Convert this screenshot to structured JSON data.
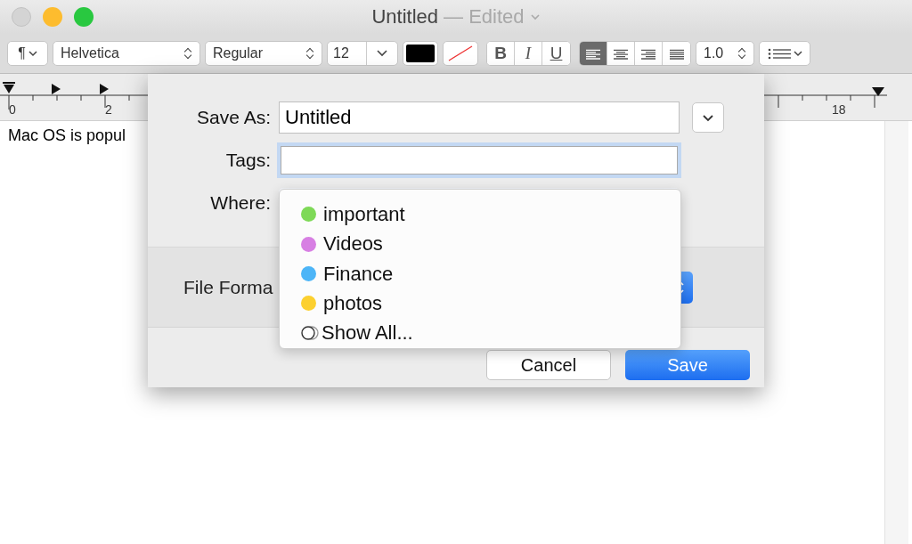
{
  "window": {
    "title": "Untitled",
    "status": "— Edited"
  },
  "toolbar": {
    "paragraph": "¶",
    "font_family": "Helvetica",
    "font_style": "Regular",
    "font_size": "12",
    "bold": "B",
    "italic": "I",
    "underline": "U",
    "line_spacing": "1.0",
    "alignments": [
      {
        "kind": "left",
        "selected": true
      },
      {
        "kind": "center",
        "selected": false
      },
      {
        "kind": "right",
        "selected": false
      },
      {
        "kind": "justify",
        "selected": false
      }
    ]
  },
  "ruler": {
    "labels": [
      "0",
      "2",
      "18"
    ]
  },
  "document": {
    "text": "Mac OS is popul"
  },
  "save_dialog": {
    "save_as_label": "Save As:",
    "save_as_value": "Untitled",
    "tags_label": "Tags:",
    "where_label": "Where:",
    "file_format_label": "File Forma",
    "tags_menu": [
      {
        "kind": "tag",
        "label": "important",
        "color": "#7ed957"
      },
      {
        "kind": "tag",
        "label": "Videos",
        "color": "#d77fe3"
      },
      {
        "kind": "tag",
        "label": "Finance",
        "color": "#4db5f7"
      },
      {
        "kind": "tag",
        "label": "photos",
        "color": "#fcd02f"
      },
      {
        "kind": "all",
        "label": "Show All..."
      }
    ],
    "buttons": [
      {
        "label": "Cancel",
        "kind": "secondary"
      },
      {
        "label": "Save",
        "kind": "primary"
      }
    ]
  }
}
